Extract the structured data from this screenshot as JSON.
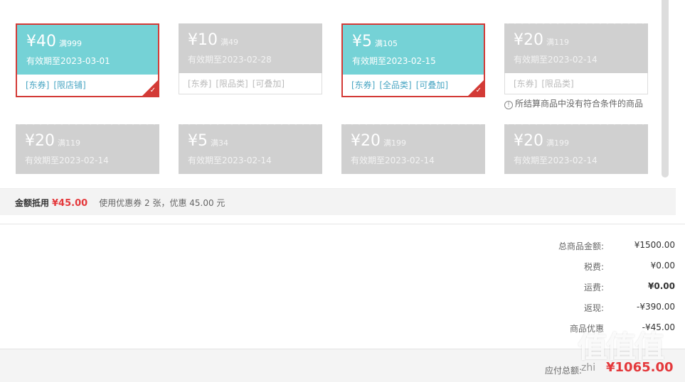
{
  "coupons": [
    {
      "amount": "¥40",
      "cond": "满999",
      "valid": "有效期至2023-03-01",
      "tags": [
        "[东券]",
        "[限店铺]"
      ],
      "selected": true
    },
    {
      "amount": "¥10",
      "cond": "满49",
      "valid": "有效期至2023-02-28",
      "tags": [
        "[东券]",
        "[限品类]",
        "[可叠加]"
      ],
      "selected": false
    },
    {
      "amount": "¥5",
      "cond": "满105",
      "valid": "有效期至2023-02-15",
      "tags": [
        "[东券]",
        "[全品类]",
        "[可叠加]"
      ],
      "selected": true
    },
    {
      "amount": "¥20",
      "cond": "满119",
      "valid": "有效期至2023-02-14",
      "tags": [
        "[东券]",
        "[限品类]"
      ],
      "selected": false
    },
    {
      "amount": "¥20",
      "cond": "满119",
      "valid": "有效期至2023-02-14",
      "tags": [],
      "selected": false
    },
    {
      "amount": "¥5",
      "cond": "满34",
      "valid": "有效期至2023-02-14",
      "tags": [],
      "selected": false
    },
    {
      "amount": "¥20",
      "cond": "满199",
      "valid": "有效期至2023-02-14",
      "tags": [],
      "selected": false
    },
    {
      "amount": "¥20",
      "cond": "满199",
      "valid": "有效期至2023-02-14",
      "tags": [],
      "selected": false
    }
  ],
  "notice": "所结算商品中没有符合条件的商品",
  "summary": {
    "label": "金额抵用",
    "amount": "¥45.00",
    "desc": "使用优惠券 2 张，优惠 45.00 元"
  },
  "totals": [
    {
      "label": "总商品金额:",
      "value": "¥1500.00"
    },
    {
      "label": "税费:",
      "value": "¥0.00"
    },
    {
      "label": "运费:",
      "value": "¥0.00"
    },
    {
      "label": "返现:",
      "value": "-¥390.00"
    },
    {
      "label": "商品优惠",
      "value": "-¥45.00"
    }
  ],
  "pay": {
    "label": "应付总额:",
    "value": "¥1065.00"
  },
  "watermark": {
    "logo": "值值值",
    "url": "zhi"
  },
  "colors": {
    "accent": "#e4393c",
    "coupon_active": "#75d2d6",
    "coupon_gray": "#d0d0d0",
    "tag_blue": "#4aa6c3"
  }
}
